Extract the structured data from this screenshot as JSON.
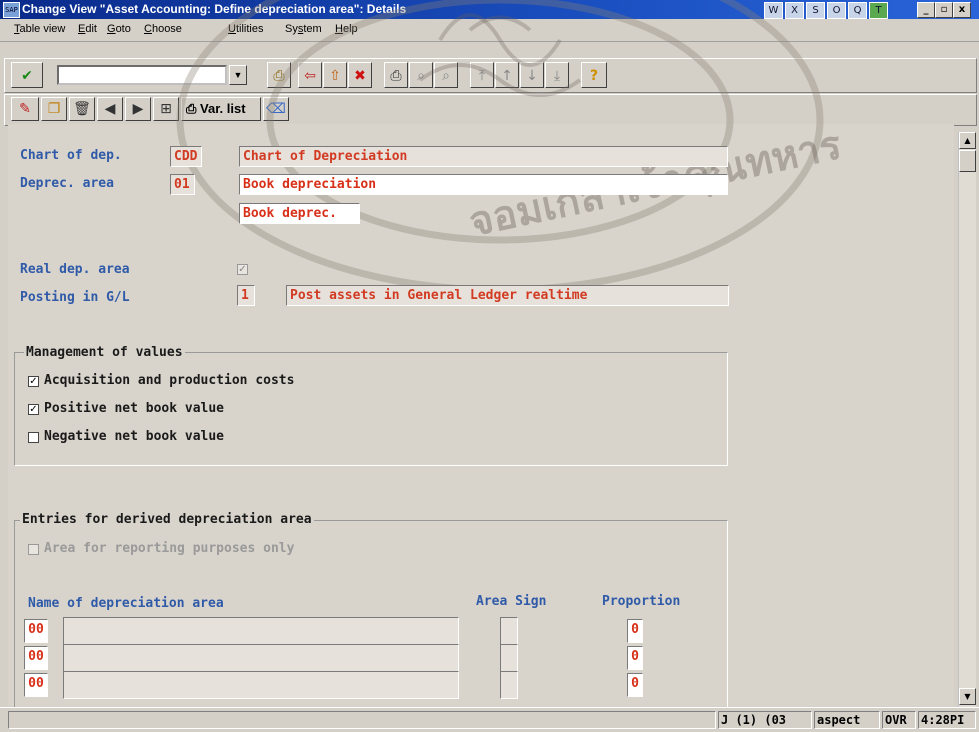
{
  "window": {
    "title": "Change View \"Asset Accounting: Define depreciation area\": Details",
    "app_icon_text": "SAP",
    "title_icons": [
      "W",
      "X",
      "S",
      "O",
      "Q",
      "T"
    ],
    "win_buttons": [
      "_",
      "▫",
      "x"
    ]
  },
  "menu": [
    {
      "pre": "",
      "u": "T",
      "post": "able view"
    },
    {
      "pre": "",
      "u": "E",
      "post": "dit"
    },
    {
      "pre": "",
      "u": "G",
      "post": "oto"
    },
    {
      "pre": "",
      "u": "C",
      "post": "hoose"
    },
    {
      "pre": "",
      "u": "U",
      "post": "tilities"
    },
    {
      "pre": "Sy",
      "u": "s",
      "post": "tem"
    },
    {
      "pre": "",
      "u": "H",
      "post": "elp"
    }
  ],
  "toolbar2": {
    "varlist_label": "Var. list"
  },
  "form": {
    "chart_of_dep": {
      "label": "Chart of dep.",
      "code": "CDD",
      "text": "Chart of Depreciation"
    },
    "deprec_area": {
      "label": "Deprec. area",
      "code": "01",
      "text": "Book depreciation",
      "short_text": "Book deprec."
    },
    "real_dep_area": {
      "label": "Real dep. area",
      "checked": true
    },
    "posting_gl": {
      "label": "Posting in G/L",
      "code": "1",
      "text": "Post assets in General Ledger realtime"
    }
  },
  "management": {
    "title": "Management of values",
    "items": [
      {
        "label": "Acquisition and production costs",
        "checked": true
      },
      {
        "label": "Positive net book value",
        "checked": true
      },
      {
        "label": "Negative net book value",
        "checked": false
      }
    ]
  },
  "derived": {
    "title": "Entries for derived depreciation area",
    "reporting_label": "Area for reporting purposes only",
    "col_name": "Name of depreciation area",
    "col_sign": "Area Sign",
    "col_prop": "Proportion",
    "rows": [
      {
        "code": "00",
        "name": "",
        "sign": "",
        "prop": "0"
      },
      {
        "code": "00",
        "name": "",
        "sign": "",
        "prop": "0"
      },
      {
        "code": "00",
        "name": "",
        "sign": "",
        "prop": "0"
      }
    ]
  },
  "status": {
    "session": "J (1) (03",
    "host": "aspect",
    "mode": "OVR",
    "time": "4:28PI"
  },
  "watermark_text": "จอมเกล้าเจ้าคุณทหาร"
}
